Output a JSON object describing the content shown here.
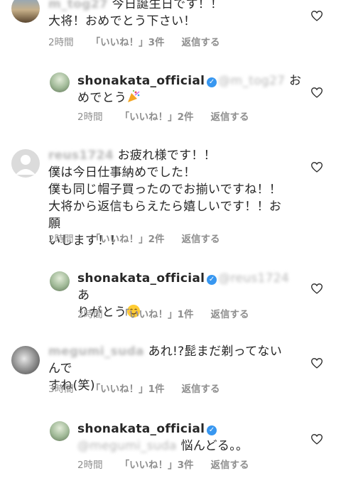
{
  "comments": [
    {
      "username_blurred": "m_tog27",
      "text_lines": [
        "今日誕生日です！！",
        "大将！おめでとう下さい！"
      ],
      "time": "2時間",
      "likes": "「いいね！」3件",
      "reply": "返信する",
      "avatar_icon": "user-photo-avatar"
    },
    {
      "username": "shonakata_official",
      "mention_blurred": "@m_tog27",
      "text_lines": [
        "お",
        "めでとう"
      ],
      "emoji": "party-popper-emoji",
      "time": "2時間",
      "likes": "「いいね！」2件",
      "reply": "返信する"
    },
    {
      "username_blurred": "reus1724",
      "text_lines": [
        "お疲れ様です！！",
        "僕は今日仕事納めでした！",
        "僕も同じ帽子買ったのでお揃いですね！！",
        "大将から返信もらえたら嬉しいです！！お願",
        "いします！！"
      ],
      "time": "2時間",
      "likes": "「いいね！」2件",
      "reply": "返信する",
      "avatar_icon": "default-avatar-icon"
    },
    {
      "username": "shonakata_official",
      "mention_blurred": "@reus1724",
      "text_lines": [
        "あ",
        "りがとう"
      ],
      "emoji": "smiling-face-emoji",
      "time": "2時間",
      "likes": "「いいね！」1件",
      "reply": "返信する"
    },
    {
      "username_blurred": "megumi_suda",
      "text_lines": [
        "あれ!?髭まだ剃ってないんで",
        "すね(笑)"
      ],
      "time": "3時間",
      "likes": "「いいね！」1件",
      "reply": "返信する",
      "avatar_icon": "user-photo-avatar"
    },
    {
      "username": "shonakata_official",
      "mention_blurred": "@megumi_suda",
      "text_lines": [
        "悩んどる。。"
      ],
      "time": "2時間",
      "likes": "「いいね！」3件",
      "reply": "返信する"
    }
  ]
}
